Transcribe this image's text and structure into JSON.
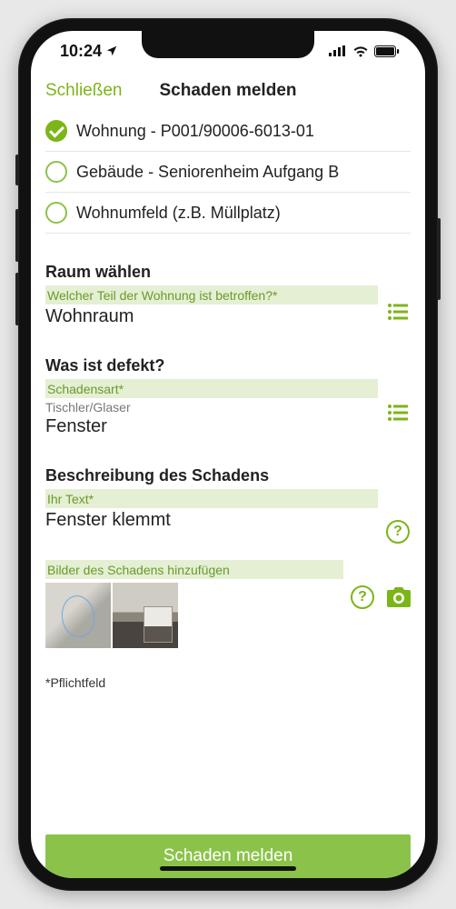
{
  "status": {
    "time": "10:24",
    "location_icon": "location-arrow"
  },
  "nav": {
    "close": "Schließen",
    "title": "Schaden melden"
  },
  "location_options": [
    {
      "label": "Wohnung - P001/90006-6013-01",
      "selected": true
    },
    {
      "label": "Gebäude - Seniorenheim Aufgang B",
      "selected": false
    },
    {
      "label": "Wohnumfeld (z.B. Müllplatz)",
      "selected": false
    }
  ],
  "room": {
    "heading": "Raum wählen",
    "band": "Welcher Teil der Wohnung ist betroffen?*",
    "value": "Wohnraum"
  },
  "defect": {
    "heading": "Was ist defekt?",
    "band": "Schadensart*",
    "category": "Tischler/Glaser",
    "value": "Fenster"
  },
  "description": {
    "heading": "Beschreibung des Schadens",
    "band": "Ihr Text*",
    "value": "Fenster klemmt"
  },
  "photos": {
    "band": "Bilder des Schadens hinzufügen",
    "count": 2
  },
  "required_note": "*Pflichtfeld",
  "submit_label": "Schaden melden"
}
